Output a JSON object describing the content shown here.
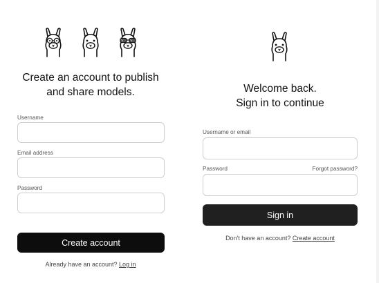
{
  "signup": {
    "mascots": [
      "llama-glasses-icon",
      "llama-icon",
      "llama-sunglasses-icon"
    ],
    "heading_line1": "Create an account to publish",
    "heading_line2": "and share models.",
    "username_label": "Username",
    "username_value": "",
    "email_label": "Email address",
    "email_value": "",
    "password_label": "Password",
    "password_value": "",
    "submit_label": "Create account",
    "footer_text": "Already have an account?",
    "footer_link": "Log in"
  },
  "signin": {
    "mascot": "llama-icon",
    "heading_line1": "Welcome back.",
    "heading_line2": "Sign in to continue",
    "username_label": "Username or email",
    "username_value": "",
    "password_label": "Password",
    "password_value": "",
    "forgot_label": "Forgot password?",
    "submit_label": "Sign in",
    "footer_text": "Don't have an account?",
    "footer_link": "Create account"
  },
  "colors": {
    "primary_button": "#0d0d0d",
    "signin_button": "#202020",
    "input_border": "#cfcfcf",
    "label_text": "#555555"
  }
}
